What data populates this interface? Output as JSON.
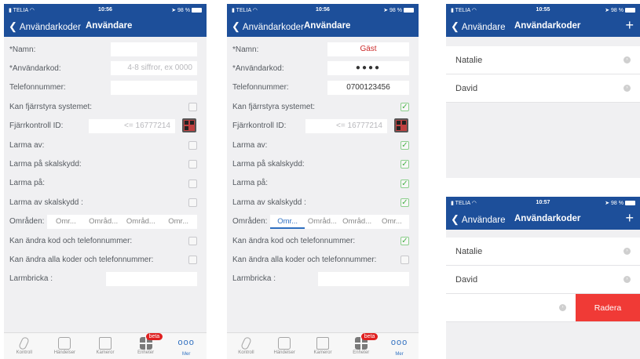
{
  "screen1": {
    "status": {
      "carrier": "TELIA",
      "time": "10:56",
      "battery": "98 %"
    },
    "nav": {
      "back": "Användarkoder",
      "title": "Användare"
    },
    "rows": {
      "namn": "*Namn:",
      "kod": "*Användarkod:",
      "kod_placeholder": "4-8 siffror, ex 0000",
      "tel": "Telefonnummer:",
      "fjarr": "Kan fjärrstyra systemet:",
      "fjarrid": "Fjärrkontroll ID:",
      "fjarrid_placeholder": "<= 16777214",
      "larmaav": "Larma av:",
      "skal": "Larma på skalskydd:",
      "larmapa": "Larma på:",
      "larmaavskal": "Larma av skalskydd :",
      "omraden": "Områden:",
      "andrakod": "Kan ändra kod och telefonnummer:",
      "andraalla": "Kan ändra alla koder och telefonnummer:",
      "bricka": "Larmbricka :"
    },
    "areas": [
      "Omr...",
      "Områd...",
      "Områd...",
      "Omr..."
    ]
  },
  "screen2": {
    "status": {
      "carrier": "TELIA",
      "time": "10:56",
      "battery": "98 %"
    },
    "nav": {
      "back": "Användarkoder",
      "title": "Användare"
    },
    "name_value": "Gäst",
    "code_value": "●●●●",
    "phone_value": "0700123456",
    "areas": [
      "Omr...",
      "Områd...",
      "Områd...",
      "Omr..."
    ]
  },
  "screen3": {
    "status": {
      "carrier": "TELIA",
      "time": "10:55",
      "battery": "98 %"
    },
    "nav": {
      "back": "Användare",
      "title": "Användarkoder",
      "plus": "+"
    },
    "users": [
      "Natalie",
      "David"
    ]
  },
  "screen4": {
    "status": {
      "carrier": "TELIA",
      "time": "10:57",
      "battery": "98 %"
    },
    "nav": {
      "back": "Användare",
      "title": "Användarkoder",
      "plus": "+"
    },
    "users": [
      "Natalie",
      "David"
    ],
    "delete_label": "Radera"
  },
  "tabbar": {
    "tabs": [
      "Kontroll",
      "Händelser",
      "Kameror",
      "Enheter",
      "Mer"
    ],
    "badge": "beta",
    "more_glyph": "ooo"
  },
  "colors": {
    "nav": "#1d4f9a",
    "active": "#2f6fc0",
    "delete": "#f03a36",
    "check": "#47b047"
  }
}
